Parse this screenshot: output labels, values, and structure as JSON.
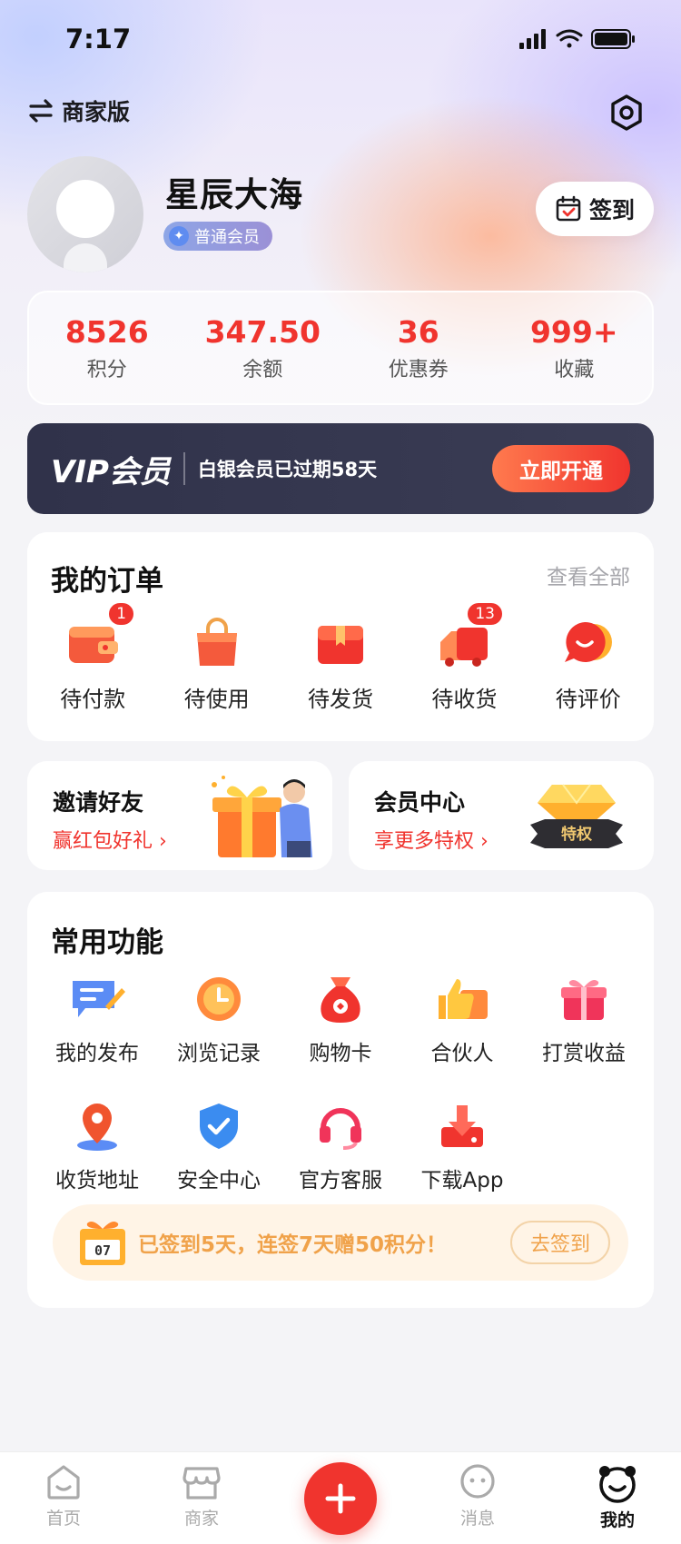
{
  "status_bar": {
    "time": "7:17"
  },
  "header": {
    "switch_label": "商家版"
  },
  "profile": {
    "username": "星辰大海",
    "member_level": "普通会员",
    "checkin_label": "签到"
  },
  "stats": [
    {
      "value": "8526",
      "label": "积分"
    },
    {
      "value": "347.50",
      "label": "余额"
    },
    {
      "value": "36",
      "label": "优惠券"
    },
    {
      "value": "999+",
      "label": "收藏"
    }
  ],
  "vip": {
    "title": "VIP会员",
    "description": "白银会员已过期58天",
    "button": "立即开通"
  },
  "orders": {
    "title": "我的订单",
    "view_all": "查看全部",
    "items": [
      {
        "label": "待付款",
        "badge": "1",
        "icon": "wallet-icon"
      },
      {
        "label": "待使用",
        "badge": "",
        "icon": "shopping-bag-icon"
      },
      {
        "label": "待发货",
        "badge": "",
        "icon": "box-icon"
      },
      {
        "label": "待收货",
        "badge": "13",
        "icon": "delivery-truck-icon"
      },
      {
        "label": "待评价",
        "badge": "",
        "icon": "chat-bubble-icon"
      }
    ]
  },
  "promos": {
    "invite": {
      "title": "邀请好友",
      "subtitle": "赢红包好礼 ›"
    },
    "member_center": {
      "title": "会员中心",
      "subtitle": "享更多特权 ›",
      "badge": "特权"
    }
  },
  "functions": {
    "title": "常用功能",
    "items": [
      {
        "label": "我的发布",
        "icon": "publish-icon"
      },
      {
        "label": "浏览记录",
        "icon": "clock-icon"
      },
      {
        "label": "购物卡",
        "icon": "money-bag-icon"
      },
      {
        "label": "合伙人",
        "icon": "thumbs-up-icon"
      },
      {
        "label": "打赏收益",
        "icon": "gift-icon"
      },
      {
        "label": "收货地址",
        "icon": "location-pin-icon"
      },
      {
        "label": "安全中心",
        "icon": "shield-icon"
      },
      {
        "label": "官方客服",
        "icon": "headset-icon"
      },
      {
        "label": "下载App",
        "icon": "download-icon"
      }
    ],
    "checkin_banner": {
      "message": "已签到5天，连签7天赠50积分！",
      "calendar_text": "07",
      "button": "去签到"
    }
  },
  "tabbar": {
    "tabs": [
      {
        "label": "首页",
        "icon": "home-icon"
      },
      {
        "label": "商家",
        "icon": "store-icon"
      },
      {
        "label": "消息",
        "icon": "message-icon"
      },
      {
        "label": "我的",
        "icon": "profile-icon",
        "active": true
      }
    ]
  },
  "colors": {
    "accent_red": "#f0342e",
    "vip_dark": "#30324a",
    "checkin_orange": "#f0a24a"
  }
}
